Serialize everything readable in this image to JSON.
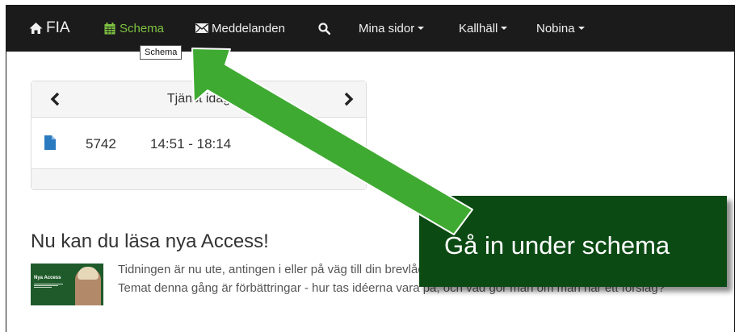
{
  "navbar": {
    "brand": "FIA",
    "schema": "Schema",
    "messages": "Meddelanden",
    "mina_sidor": "Mina sidor",
    "kallhall": "Kallhäll",
    "nobina": "Nobina"
  },
  "tooltip": "Schema",
  "panel": {
    "title": "Tjänst idag",
    "shift_number": "5742",
    "shift_time": "14:51 - 18:14"
  },
  "news": {
    "title": "Nu kan du läsa nya Access!",
    "body": "Tidningen är nu ute, antingen i eller på väg till din brevlåda. Du kan även läsa den digitalt i länken nedan. Temat denna gång är förbättringar - hur tas idéerna vara på, och vad gör man om man har ett förslag?",
    "thumb_title": "Nya Access"
  },
  "callout": {
    "text": "Gå in under schema"
  },
  "colors": {
    "navbar_bg": "#1b1b1b",
    "active_nav": "#7ec242",
    "callout_bg": "#0c4a14",
    "arrow_fill": "#3faa32",
    "link_icon": "#2a7ac0"
  }
}
